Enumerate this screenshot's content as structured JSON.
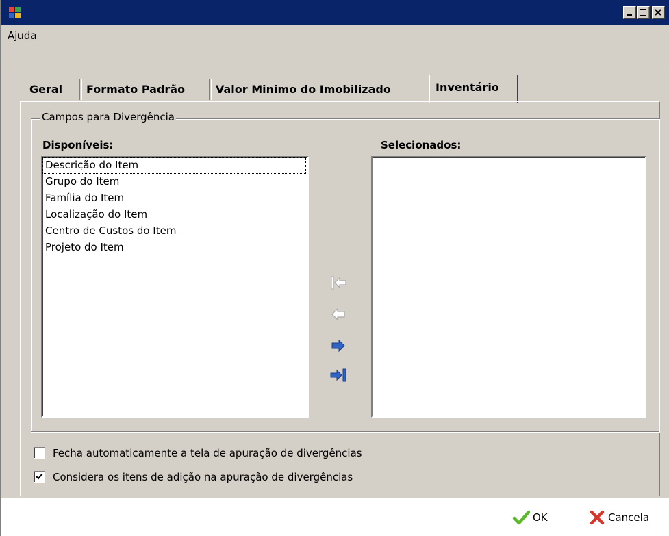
{
  "window": {
    "menu": [
      "Ajuda"
    ]
  },
  "tabs": [
    "Geral",
    "Formato Padrão",
    "Valor Minimo do Imobilizado",
    "Inventário"
  ],
  "active_tab": "Inventário",
  "group": {
    "title": "Campos para Divergência",
    "available_label": "Disponíveis:",
    "selected_label": "Selecionados:",
    "available_items": [
      "Descrição do Item",
      "Grupo do Item",
      "Família do Item",
      "Localização do Item",
      "Centro de Custos do Item",
      "Projeto do Item"
    ],
    "selected_items": []
  },
  "transfer_buttons": {
    "remove_all_icon": "double-arrow-left-icon",
    "remove_one_icon": "arrow-left-icon",
    "add_one_icon": "arrow-right-icon",
    "add_all_icon": "double-arrow-right-icon"
  },
  "options": {
    "auto_close_label": "Fecha automaticamente a tela de apuração de divergências",
    "auto_close_checked": false,
    "include_addition_label": "Considera os itens de adição na apuração de divergências",
    "include_addition_checked": true
  },
  "footer": {
    "ok_label": "OK",
    "cancel_label": "Cancela"
  },
  "colors": {
    "titlebar": "#0a246a",
    "face": "#d4d0c8",
    "arrow_active": "#2f63c6",
    "ok_check": "#5cb82a",
    "cancel_x": "#d6372c"
  }
}
